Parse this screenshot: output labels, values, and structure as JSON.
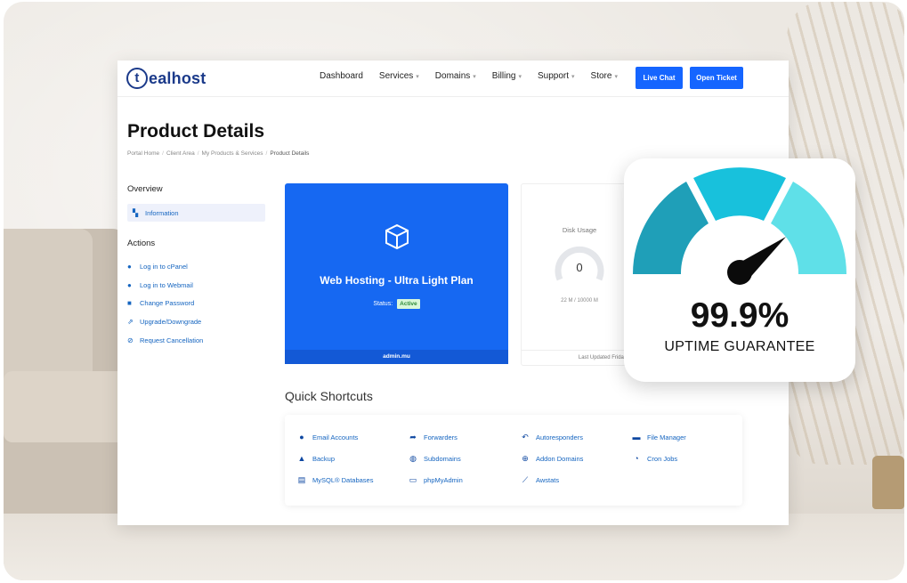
{
  "brand": {
    "logo_text": "ealhost",
    "logo_initial": "t",
    "accent": "#1565ff",
    "navy": "#1b3a8a"
  },
  "nav": {
    "items": [
      {
        "label": "Dashboard",
        "dropdown": false
      },
      {
        "label": "Services",
        "dropdown": true
      },
      {
        "label": "Domains",
        "dropdown": true
      },
      {
        "label": "Billing",
        "dropdown": true
      },
      {
        "label": "Support",
        "dropdown": true
      },
      {
        "label": "Store",
        "dropdown": true
      }
    ],
    "live_chat": "Live Chat",
    "open_ticket": "Open Ticket"
  },
  "page": {
    "title": "Product Details",
    "breadcrumb": [
      "Portal Home",
      "Client Area",
      "My Products & Services",
      "Product Details"
    ]
  },
  "sidebar": {
    "overview_heading": "Overview",
    "overview_item": "Information",
    "actions_heading": "Actions",
    "actions": [
      {
        "label": "Log in to cPanel",
        "icon": "user-icon"
      },
      {
        "label": "Log in to Webmail",
        "icon": "user-icon"
      },
      {
        "label": "Change Password",
        "icon": "lock-icon"
      },
      {
        "label": "Upgrade/Downgrade",
        "icon": "upgrade-icon"
      },
      {
        "label": "Request Cancellation",
        "icon": "ban-icon"
      }
    ]
  },
  "product": {
    "plan": "Web Hosting - Ultra Light Plan",
    "status_label": "Status:",
    "status": "Active",
    "username": "admin.mu"
  },
  "disk": {
    "label": "Disk Usage",
    "value": "0",
    "usage": "22 M / 10000 M",
    "updated": "Last Updated Friday, 1"
  },
  "shortcuts": {
    "title": "Quick Shortcuts",
    "items": [
      {
        "label": "Email Accounts",
        "icon": "user-icon"
      },
      {
        "label": "Forwarders",
        "icon": "share-icon"
      },
      {
        "label": "Autoresponders",
        "icon": "reply-icon"
      },
      {
        "label": "File Manager",
        "icon": "folder-icon"
      },
      {
        "label": "Backup",
        "icon": "backup-icon"
      },
      {
        "label": "Subdomains",
        "icon": "globe-icon"
      },
      {
        "label": "Addon Domains",
        "icon": "plus-circle-icon"
      },
      {
        "label": "Cron Jobs",
        "icon": "clock-icon"
      },
      {
        "label": "MySQL® Databases",
        "icon": "database-icon"
      },
      {
        "label": "phpMyAdmin",
        "icon": "window-icon"
      },
      {
        "label": "Awstats",
        "icon": "chart-icon"
      }
    ]
  },
  "uptime": {
    "value": "99.9%",
    "caption": "UPTIME GUARANTEE",
    "colors": [
      "#1f9fb8",
      "#18c1dc",
      "#5fe0e8"
    ]
  }
}
